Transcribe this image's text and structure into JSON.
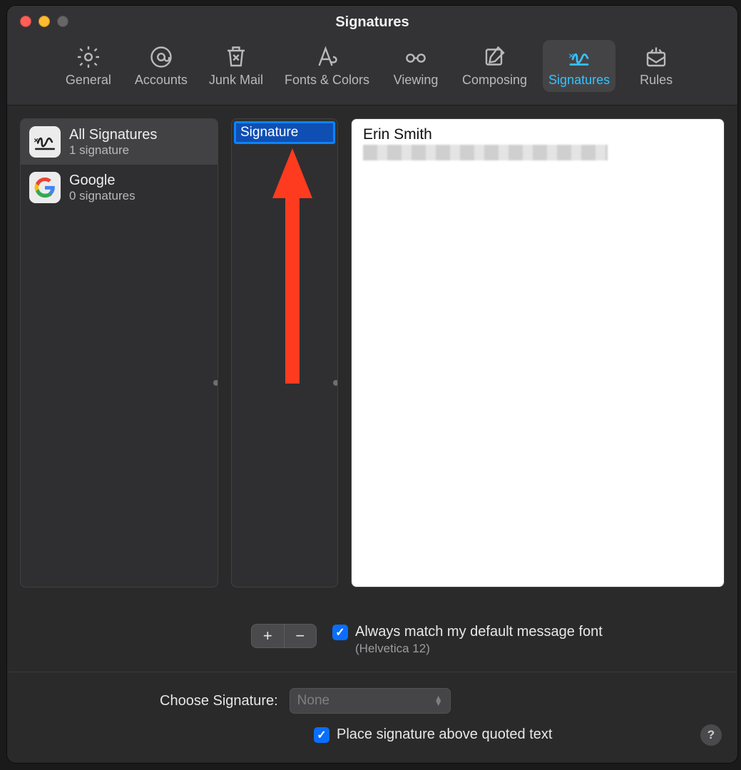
{
  "window": {
    "title": "Signatures"
  },
  "toolbar": {
    "items": [
      {
        "id": "general",
        "label": "General"
      },
      {
        "id": "accounts",
        "label": "Accounts"
      },
      {
        "id": "junk-mail",
        "label": "Junk Mail"
      },
      {
        "id": "fonts-colors",
        "label": "Fonts & Colors"
      },
      {
        "id": "viewing",
        "label": "Viewing"
      },
      {
        "id": "composing",
        "label": "Composing"
      },
      {
        "id": "signatures",
        "label": "Signatures"
      },
      {
        "id": "rules",
        "label": "Rules"
      }
    ],
    "activeId": "signatures"
  },
  "accounts": [
    {
      "id": "all",
      "title": "All Signatures",
      "subtitle": "1 signature",
      "selected": true
    },
    {
      "id": "google",
      "title": "Google",
      "subtitle": "0 signatures",
      "selected": false
    }
  ],
  "signatureList": {
    "editingName": "Signature"
  },
  "editor": {
    "name": "Erin Smith"
  },
  "controls": {
    "matchFontLabel": "Always match my default message font",
    "matchFontChecked": true,
    "fontNote": "(Helvetica 12)"
  },
  "footer": {
    "chooseLabel": "Choose Signature:",
    "selectValue": "None",
    "placeAboveLabel": "Place signature above quoted text",
    "placeAboveChecked": true
  }
}
